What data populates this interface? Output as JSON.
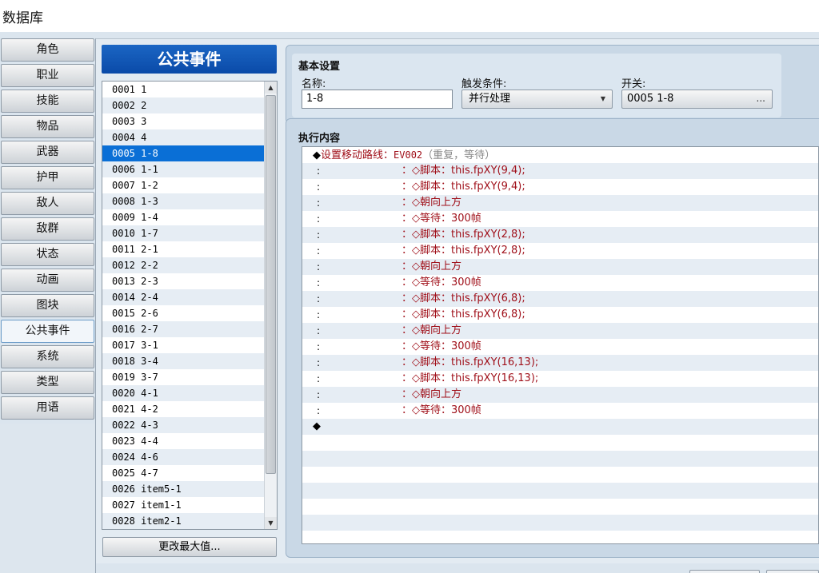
{
  "window": {
    "title": "数据库"
  },
  "tabs": [
    {
      "label": "角色"
    },
    {
      "label": "职业"
    },
    {
      "label": "技能"
    },
    {
      "label": "物品"
    },
    {
      "label": "武器"
    },
    {
      "label": "护甲"
    },
    {
      "label": "敌人"
    },
    {
      "label": "敌群"
    },
    {
      "label": "状态"
    },
    {
      "label": "动画"
    },
    {
      "label": "图块"
    },
    {
      "label": "公共事件"
    },
    {
      "label": "系统"
    },
    {
      "label": "类型"
    },
    {
      "label": "用语"
    }
  ],
  "active_tab": "公共事件",
  "list": {
    "header": "公共事件",
    "selected": "0005 1-8",
    "items": [
      "0001 1",
      "0002 2",
      "0003 3",
      "0004 4",
      "0005 1-8",
      "0006 1-1",
      "0007 1-2",
      "0008 1-3",
      "0009 1-4",
      "0010 1-7",
      "0011 2-1",
      "0012 2-2",
      "0013 2-3",
      "0014 2-4",
      "0015 2-6",
      "0016 2-7",
      "0017 3-1",
      "0018 3-4",
      "0019 3-7",
      "0020 4-1",
      "0021 4-2",
      "0022 4-3",
      "0023 4-4",
      "0024 4-6",
      "0025 4-7",
      "0026 item5-1",
      "0027 item1-1",
      "0028 item2-1"
    ],
    "max_button": "更改最大值..."
  },
  "general": {
    "title": "基本设置",
    "name_label": "名称:",
    "name_value": "1-8",
    "trigger_label": "触发条件:",
    "trigger_value": "并行处理",
    "switch_label": "开关:",
    "switch_value": "0005 1-8",
    "switch_button": "..."
  },
  "contents": {
    "title": "执行内容",
    "first_diamond": "◆",
    "first_command": "设置移动路线：",
    "first_target": "EV002",
    "first_options": "（重复，等待）",
    "colon": ":",
    "sub_commands": [
      "：◇脚本：this.fpXY(9,4);",
      "：◇脚本：this.fpXY(9,4);",
      "：◇朝向上方",
      "：◇等待：300帧",
      "：◇脚本：this.fpXY(2,8);",
      "：◇脚本：this.fpXY(2,8);",
      "：◇朝向上方",
      "：◇等待：300帧",
      "：◇脚本：this.fpXY(6,8);",
      "：◇脚本：this.fpXY(6,8);",
      "：◇朝向上方",
      "：◇等待：300帧",
      "：◇脚本：this.fpXY(16,13);",
      "：◇脚本：this.fpXY(16,13);",
      "：◇朝向上方",
      "：◇等待：300帧"
    ],
    "end_marker": "◆"
  }
}
